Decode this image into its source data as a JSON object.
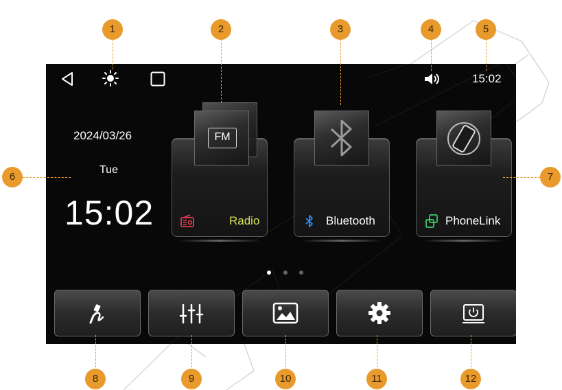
{
  "status_bar": {
    "time": "15:02",
    "icons": [
      "back-icon",
      "brightness-icon",
      "square-icon",
      "volume-icon"
    ]
  },
  "clock_widget": {
    "date": "2024/03/26",
    "weekday": "Tue",
    "time": "15:02"
  },
  "apps": [
    {
      "name": "radio",
      "label": "Radio",
      "tile_text": "FM",
      "label_color": "#d8e05a",
      "icon_color": "#e0394a"
    },
    {
      "name": "bluetooth",
      "label": "Bluetooth",
      "icon_color": "#2f8ff0"
    },
    {
      "name": "phonelink",
      "label": "PhoneLink",
      "icon_color": "#3fd46a"
    }
  ],
  "page_indicator": {
    "pages": 3,
    "current": 1
  },
  "bottom_buttons": [
    "carplay-cable-icon",
    "equalizer-icon",
    "gallery-icon",
    "settings-gear-icon",
    "screen-off-icon"
  ],
  "callouts": [
    "1",
    "2",
    "3",
    "4",
    "5",
    "6",
    "7",
    "8",
    "9",
    "10",
    "11",
    "12"
  ],
  "colors": {
    "callout": "#E99A2C",
    "screen_bg": "#080808"
  }
}
